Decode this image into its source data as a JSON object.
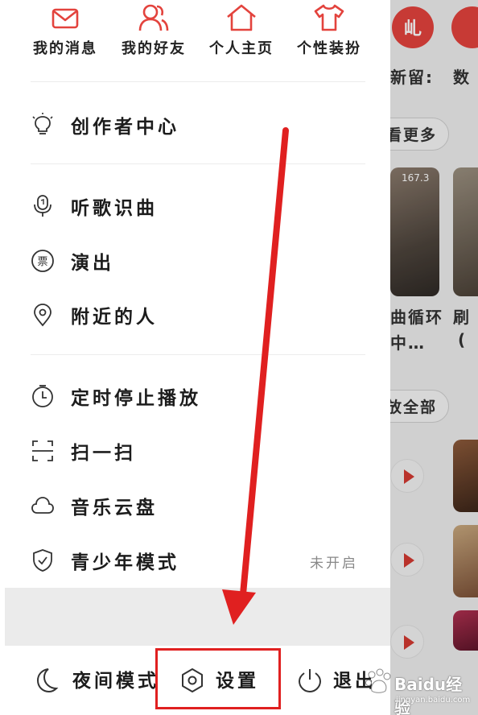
{
  "quick_actions": [
    {
      "label": "我的消息",
      "icon": "mail-icon"
    },
    {
      "label": "我的好友",
      "icon": "friends-icon"
    },
    {
      "label": "个人主页",
      "icon": "home-icon"
    },
    {
      "label": "个性装扮",
      "icon": "tshirt-icon"
    }
  ],
  "menu": {
    "creator_center": "创作者中心",
    "song_recognition": "听歌识曲",
    "performance": "演出",
    "nearby": "附近的人",
    "sleep_timer": "定时停止播放",
    "scan": "扫一扫",
    "cloud_disk": "音乐云盘",
    "teen_mode": "青少年模式",
    "teen_mode_status": "未开启"
  },
  "bottom_bar": {
    "night_mode": "夜间模式",
    "settings": "设置",
    "logout": "退出"
  },
  "background_app": {
    "badge": "乢",
    "text_1": "新留:",
    "text_2": "数",
    "more": "看更多",
    "thumb_label": "167.3",
    "song_1": "曲循环",
    "song_1_sub": "中…",
    "song_2": "刷",
    "song_2_sub": "(",
    "play_all": "放全部"
  },
  "watermark": {
    "text": "Baidu经验",
    "sub": "jingyan.baidu.com"
  },
  "colors": {
    "accent": "#e3433d",
    "annotation": "#e02020",
    "text": "#1c1c1c",
    "muted": "#888888"
  }
}
